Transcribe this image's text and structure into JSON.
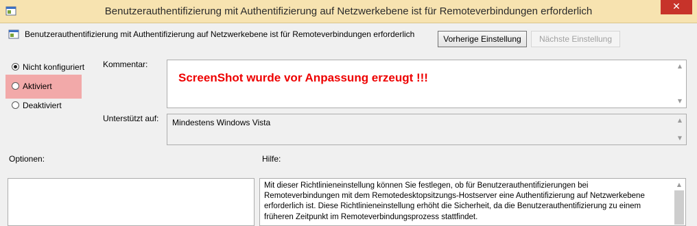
{
  "window": {
    "title": "Benutzerauthentifizierung mit Authentifizierung auf Netzwerkebene ist für Remoteverbindungen erforderlich",
    "close_glyph": "✕"
  },
  "header": {
    "setting_name": "Benutzerauthentifizierung mit Authentifizierung auf Netzwerkebene ist für Remoteverbindungen erforderlich",
    "prev_label": "Vorherige Einstellung",
    "next_label": "Nächste Einstellung"
  },
  "state": {
    "options": [
      {
        "label": "Nicht konfiguriert",
        "checked": true
      },
      {
        "label": "Aktiviert",
        "checked": false
      },
      {
        "label": "Deaktiviert",
        "checked": false
      }
    ]
  },
  "comment": {
    "label": "Kommentar:",
    "value": "ScreenShot wurde vor Anpassung erzeugt !!!"
  },
  "supported": {
    "label": "Unterstützt auf:",
    "value": "Mindestens Windows Vista"
  },
  "options_label": "Optionen:",
  "help": {
    "label": "Hilfe:",
    "lines": [
      "Mit dieser Richtlinieneinstellung können Sie festlegen, ob für Benutzerauthentifizierungen bei",
      "Remoteverbindungen mit dem Remotedesktopsitzungs-Hostserver eine Authentifizierung auf Netzwerkebene",
      "erforderlich ist. Diese Richtlinieneinstellung erhöht die Sicherheit, da die Benutzerauthentifizierung zu einem",
      "früheren Zeitpunkt im Remoteverbindungsprozess stattfindet."
    ]
  },
  "colors": {
    "title_bar": "#f7e3b0",
    "close_button": "#c7332a",
    "highlight": "#f2a9a9",
    "comment_text": "#e00000"
  }
}
